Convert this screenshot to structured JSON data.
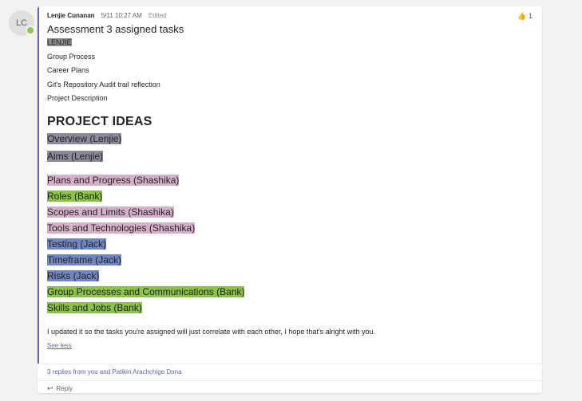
{
  "avatar": {
    "initials": "LC",
    "presence_color": "#92c353"
  },
  "message": {
    "author": "Lenjie Cunanan",
    "timestamp": "5/11 10:27 AM",
    "edited_label": "Edited",
    "reaction": {
      "icon": "thumbs-up-icon",
      "glyph": "👍",
      "count": "1"
    },
    "subject": "Assessment 3 assigned tasks",
    "owner_tag": "LENJIE",
    "owner_tasks": [
      "Group Process",
      "Career Plans",
      "Git's Repository Audit trail reflection",
      "Project Description"
    ],
    "heading": "PROJECT IDEAS",
    "ideas_group1": [
      "Overview (Lenjie)",
      "Aims (Lenjie)"
    ],
    "ideas_group2": [
      "Plans and Progress (Shashika)",
      "Roles (Bank)",
      "Scopes and Limits (Shashika)",
      "Tools and Technologies (Shashika)",
      "Testing (Jack)",
      "Timeframe (Jack)",
      "Risks (Jack)",
      "Group Processes and Communications (Bank)",
      "Skills and Jobs (Bank)"
    ],
    "note": "I updated it so the tasks you're assigned will just correlate with each other, I hope that's alright with you.",
    "see_less_label": "See less"
  },
  "thread": {
    "replies_label": "3 replies from you and Patikiri Arachchige Dona",
    "reply_label": "Reply",
    "reply_icon": "reply-arrow-icon"
  },
  "colors": {
    "accent": "#6264a7",
    "highlight_gray": "#8c8c8c",
    "highlight_pink": "#d6b0c8",
    "highlight_green": "#8bc34a",
    "highlight_blue": "#6f86c2"
  }
}
